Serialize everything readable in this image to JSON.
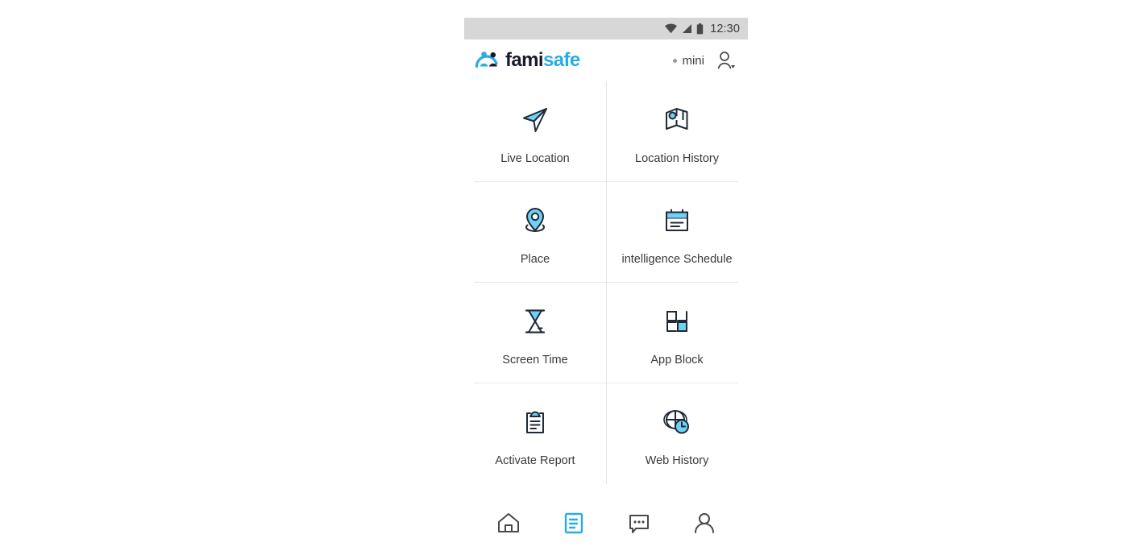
{
  "app": {
    "name": "famisafe",
    "brand_part_1": "fami",
    "brand_part_2": "safe",
    "accent_color": "#29ace3",
    "ink_color": "#1f2937"
  },
  "status_bar": {
    "time": "12:30",
    "icons": [
      "wifi-icon",
      "signal-icon",
      "battery-icon"
    ],
    "background_color": "#d7d7d7"
  },
  "header": {
    "account_label": "mini",
    "account_status_dot_color": "#9b9b9b",
    "avatar_icon": "person-dropdown-icon"
  },
  "features": [
    {
      "id": "live-location",
      "label": "Live Location",
      "icon": "paper-plane-icon"
    },
    {
      "id": "location-history",
      "label": "Location History",
      "icon": "folded-map-icon"
    },
    {
      "id": "place",
      "label": "Place",
      "icon": "map-pin-icon"
    },
    {
      "id": "intelligence-schedule",
      "label": "intelligence Schedule",
      "icon": "calendar-icon"
    },
    {
      "id": "screen-time",
      "label": "Screen Time",
      "icon": "hourglass-icon"
    },
    {
      "id": "app-block",
      "label": "App Block",
      "icon": "grid-squares-icon"
    },
    {
      "id": "activate-report",
      "label": "Activate Report",
      "icon": "clipboard-icon"
    },
    {
      "id": "web-history",
      "label": "Web History",
      "icon": "globe-clock-icon"
    }
  ],
  "bottom_nav": [
    {
      "id": "home",
      "icon": "home-icon",
      "active": false
    },
    {
      "id": "report",
      "icon": "document-icon",
      "active": true
    },
    {
      "id": "chat",
      "icon": "chat-icon",
      "active": false
    },
    {
      "id": "profile",
      "icon": "person-icon",
      "active": false
    }
  ]
}
